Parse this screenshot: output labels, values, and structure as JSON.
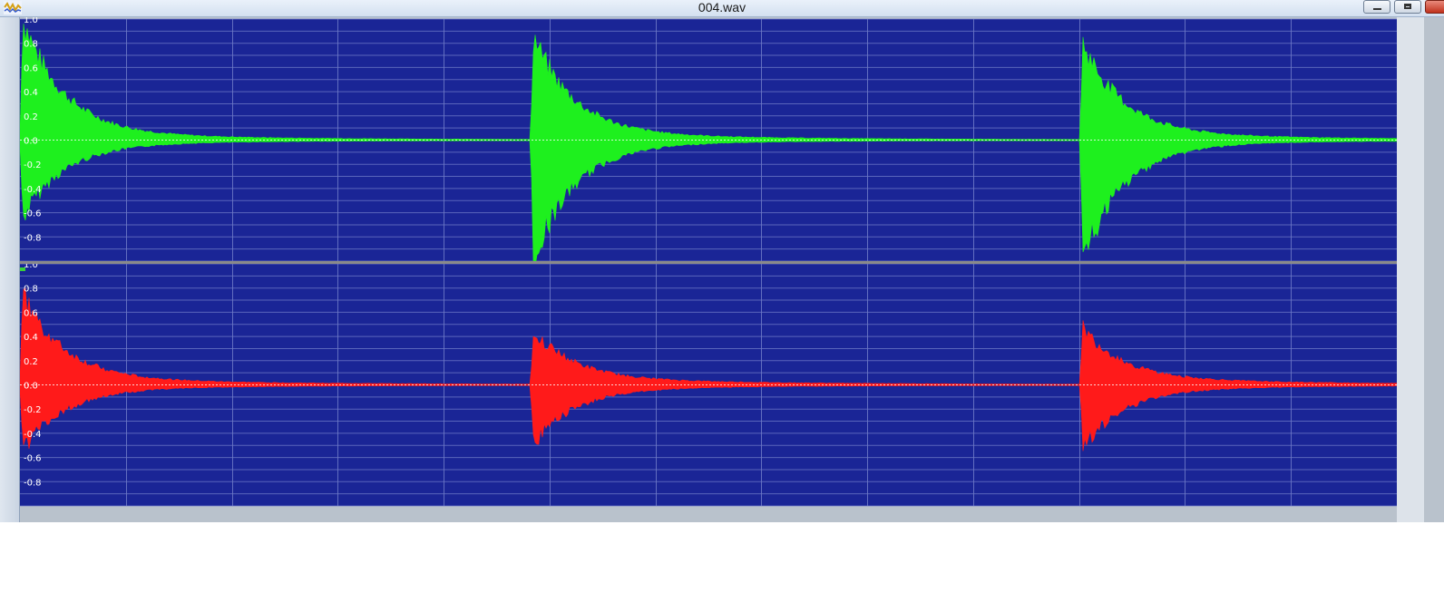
{
  "window": {
    "title": "004.wav",
    "app_icon": "waveform-app-icon",
    "controls": [
      {
        "name": "minimize-button",
        "icon": "minimize-icon"
      },
      {
        "name": "maximize-button",
        "icon": "maximize-icon"
      },
      {
        "name": "close-button",
        "icon": "close-icon"
      }
    ]
  },
  "colors": {
    "plot_background": "#1a2596",
    "grid": "#6f7bc8",
    "channel_divider": "#8a8a8a",
    "channel1_wave": "#1ef01e",
    "channel2_wave": "#ff1a1a",
    "axis_label": "#ffffff"
  },
  "channels": [
    {
      "id": "channel-1",
      "color_key": "channel1_wave",
      "y_ticks": [
        "1.0",
        "0.8",
        "0.6",
        "0.4",
        "0.2",
        "0.0",
        "-0.2",
        "-0.4",
        "-0.6",
        "-0.8"
      ]
    },
    {
      "id": "channel-2",
      "color_key": "channel2_wave",
      "y_ticks": [
        "1.0",
        "0.8",
        "0.6",
        "0.4",
        "0.2",
        "0.0",
        "-0.2",
        "-0.4",
        "-0.6",
        "-0.8"
      ]
    }
  ],
  "chart_data": {
    "type": "area",
    "ylim": [
      -1.0,
      1.0
    ],
    "grid": true,
    "vertical_gridlines": 13,
    "series": [
      {
        "strikes": [
          {
            "start": 0.0,
            "pos_peak": 0.95,
            "neg_peak": -0.6
          },
          {
            "start": 0.371,
            "pos_peak": 0.8,
            "neg_peak": -0.95
          },
          {
            "start": 0.77,
            "pos_peak": 0.75,
            "neg_peak": -0.95
          }
        ]
      },
      {
        "strikes": [
          {
            "start": 0.0,
            "pos_peak": 0.7,
            "neg_peak": -0.5
          },
          {
            "start": 0.371,
            "pos_peak": 0.4,
            "neg_peak": -0.45
          },
          {
            "start": 0.77,
            "pos_peak": 0.42,
            "neg_peak": -0.48
          }
        ]
      }
    ]
  }
}
